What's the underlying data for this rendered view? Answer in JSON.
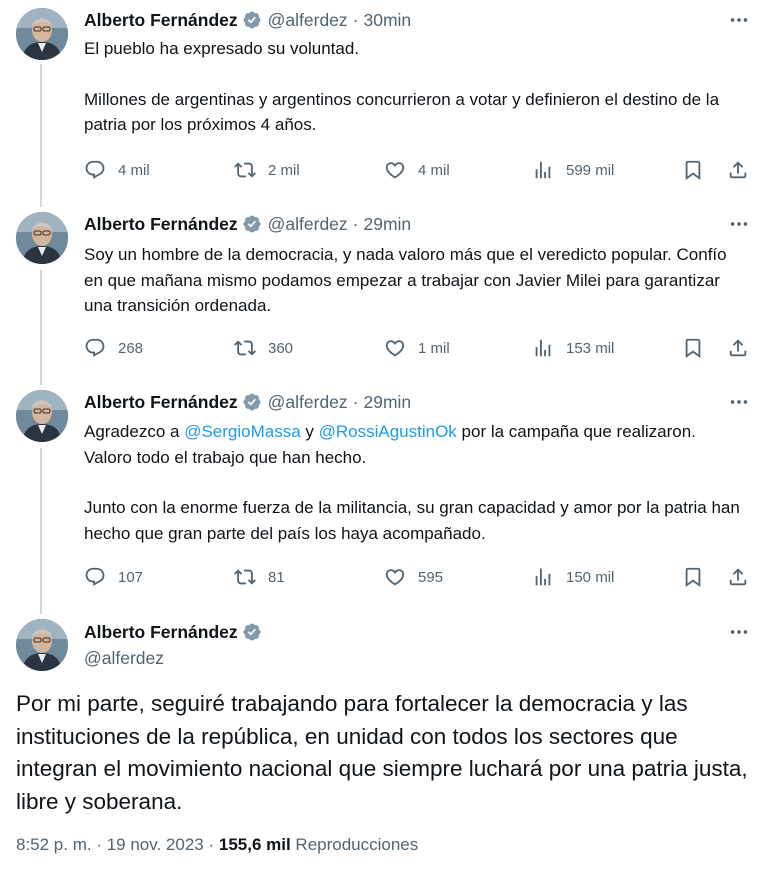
{
  "author": {
    "name": "Alberto Fernández",
    "handle": "@alferdez"
  },
  "tweets": [
    {
      "time": "30min",
      "paragraphs": [
        "El pueblo ha expresado su voluntad.",
        "Millones de argentinas y argentinos concurrieron a votar y definieron el destino de la patria por los próximos 4 años."
      ],
      "replies": "4 mil",
      "retweets": "2 mil",
      "likes": "4 mil",
      "views": "599 mil"
    },
    {
      "time": "29min",
      "paragraphs": [
        "Soy un hombre de la democracia, y nada valoro más que el veredicto popular. Confío en que mañana mismo podamos empezar a trabajar con Javier Milei para garantizar una transición ordenada."
      ],
      "replies": "268",
      "retweets": "360",
      "likes": "1 mil",
      "views": "153 mil"
    },
    {
      "time": "29min",
      "p1_before": "Agradezco a ",
      "mention1": "@SergioMassa",
      "p1_mid": " y ",
      "mention2": "@RossiAgustinOk",
      "p1_after": " por la campaña que realizaron. Valoro todo el trabajo que han hecho.",
      "p2": "Junto con la enorme fuerza de la militancia, su gran capacidad y amor por la patria han hecho que gran parte del país los haya acompañado.",
      "replies": "107",
      "retweets": "81",
      "likes": "595",
      "views": "150 mil"
    }
  ],
  "main_tweet": {
    "text": "Por mi parte, seguiré trabajando para fortalecer la democracia y las instituciones de la república, en unidad con todos los sectores que integran el movimiento nacional que siempre luchará por una patria justa, libre y soberana.",
    "timestamp": "8:52 p. m. · 19 nov. 2023 · ",
    "views_count": "155,6 mil",
    "views_label": " Reproducciones"
  },
  "colors": {
    "text": "#0f1419",
    "secondary": "#536471",
    "link": "#1d9bf0",
    "verified": "#829aab",
    "thread_line": "#cfd9de"
  },
  "icons": [
    "reply-icon",
    "retweet-icon",
    "like-icon",
    "views-icon",
    "bookmark-icon",
    "share-icon",
    "more-icon",
    "verified-badge-icon"
  ]
}
